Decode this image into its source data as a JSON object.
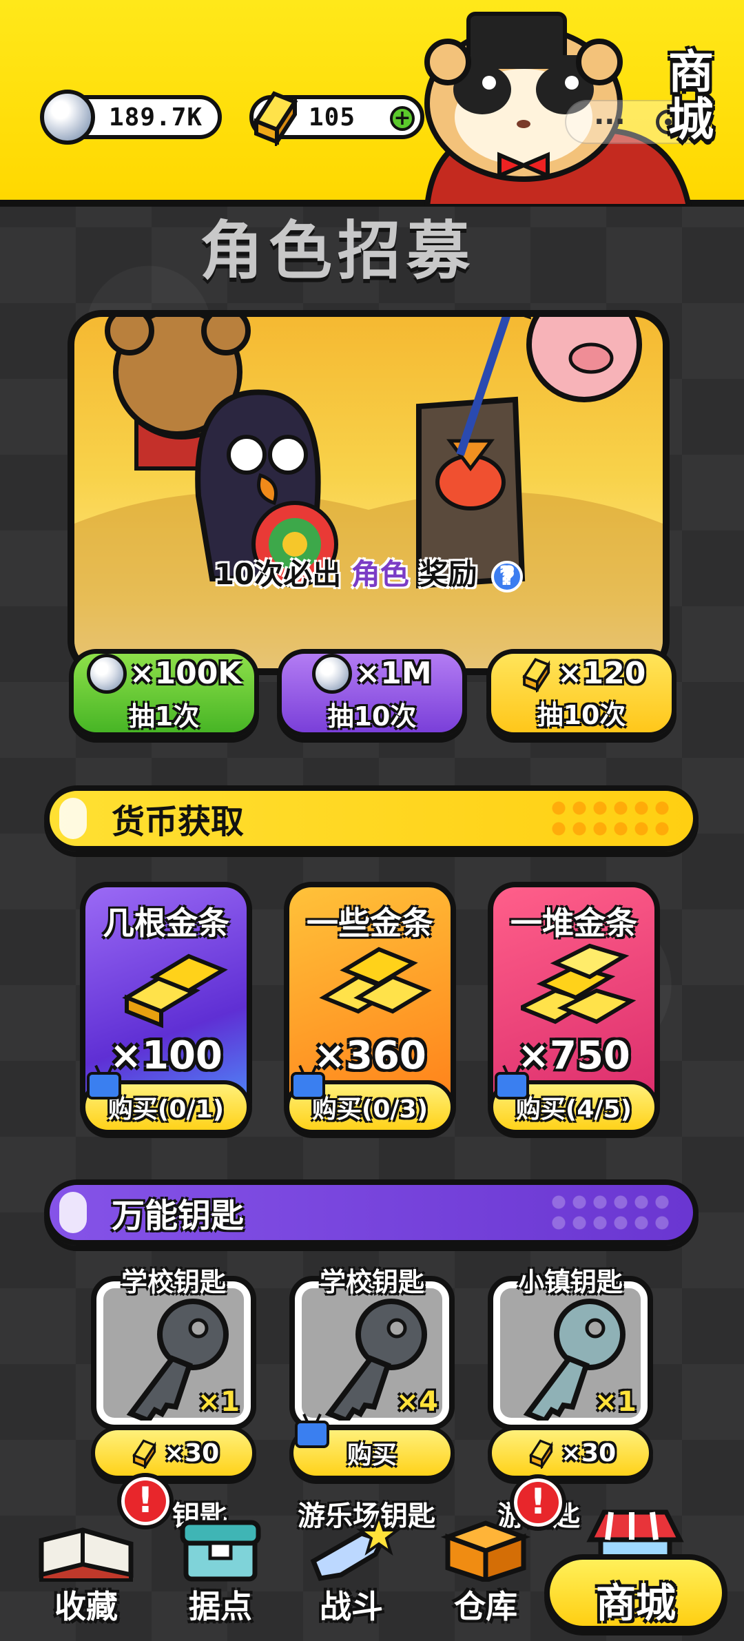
{
  "header": {
    "silver_amount": "189.7K",
    "gold_amount": "105",
    "plus_label": "+",
    "shop_title": "商城"
  },
  "banner": {
    "title": "角色招募",
    "caption_prefix": "10次必出",
    "caption_highlight": "角色",
    "caption_suffix": "奖励",
    "help_label": "?"
  },
  "draws": [
    {
      "cost": "×100K",
      "label": "抽1次",
      "currency": "silver"
    },
    {
      "cost": "×1M",
      "label": "抽10次",
      "currency": "silver"
    },
    {
      "cost": "×120",
      "label": "抽10次",
      "currency": "gold"
    }
  ],
  "currency_section": {
    "title": "货币获取",
    "cards": [
      {
        "name": "几根金条",
        "qty": "×100",
        "buy": "购买(0/1)",
        "color": "#7d4ef0"
      },
      {
        "name": "一些金条",
        "qty": "×360",
        "buy": "购买(0/3)",
        "color": "#ff9a1a"
      },
      {
        "name": "一堆金条",
        "qty": "×750",
        "buy": "购买(4/5)",
        "color": "#f0488a"
      }
    ]
  },
  "keys_section": {
    "title": "万能钥匙",
    "keys": [
      {
        "name": "学校钥匙",
        "qty": "×1",
        "buy": "×30",
        "buy_type": "gold",
        "key_color": "#555a60"
      },
      {
        "name": "学校钥匙",
        "qty": "×4",
        "buy": "购买",
        "buy_type": "ad",
        "key_color": "#555a60"
      },
      {
        "name": "小镇钥匙",
        "qty": "×1",
        "buy": "×30",
        "buy_type": "gold",
        "key_color": "#8fb1b6"
      }
    ],
    "next_row": [
      "钥匙",
      "游乐场钥匙",
      "游钥匙"
    ]
  },
  "bottom_nav": {
    "items": [
      {
        "label": "收藏",
        "icon": "book-icon"
      },
      {
        "label": "据点",
        "icon": "chest-icon"
      },
      {
        "label": "战斗",
        "icon": "gun-icon"
      },
      {
        "label": "仓库",
        "icon": "box-icon"
      }
    ],
    "active": "商城",
    "alert_label": "!"
  }
}
